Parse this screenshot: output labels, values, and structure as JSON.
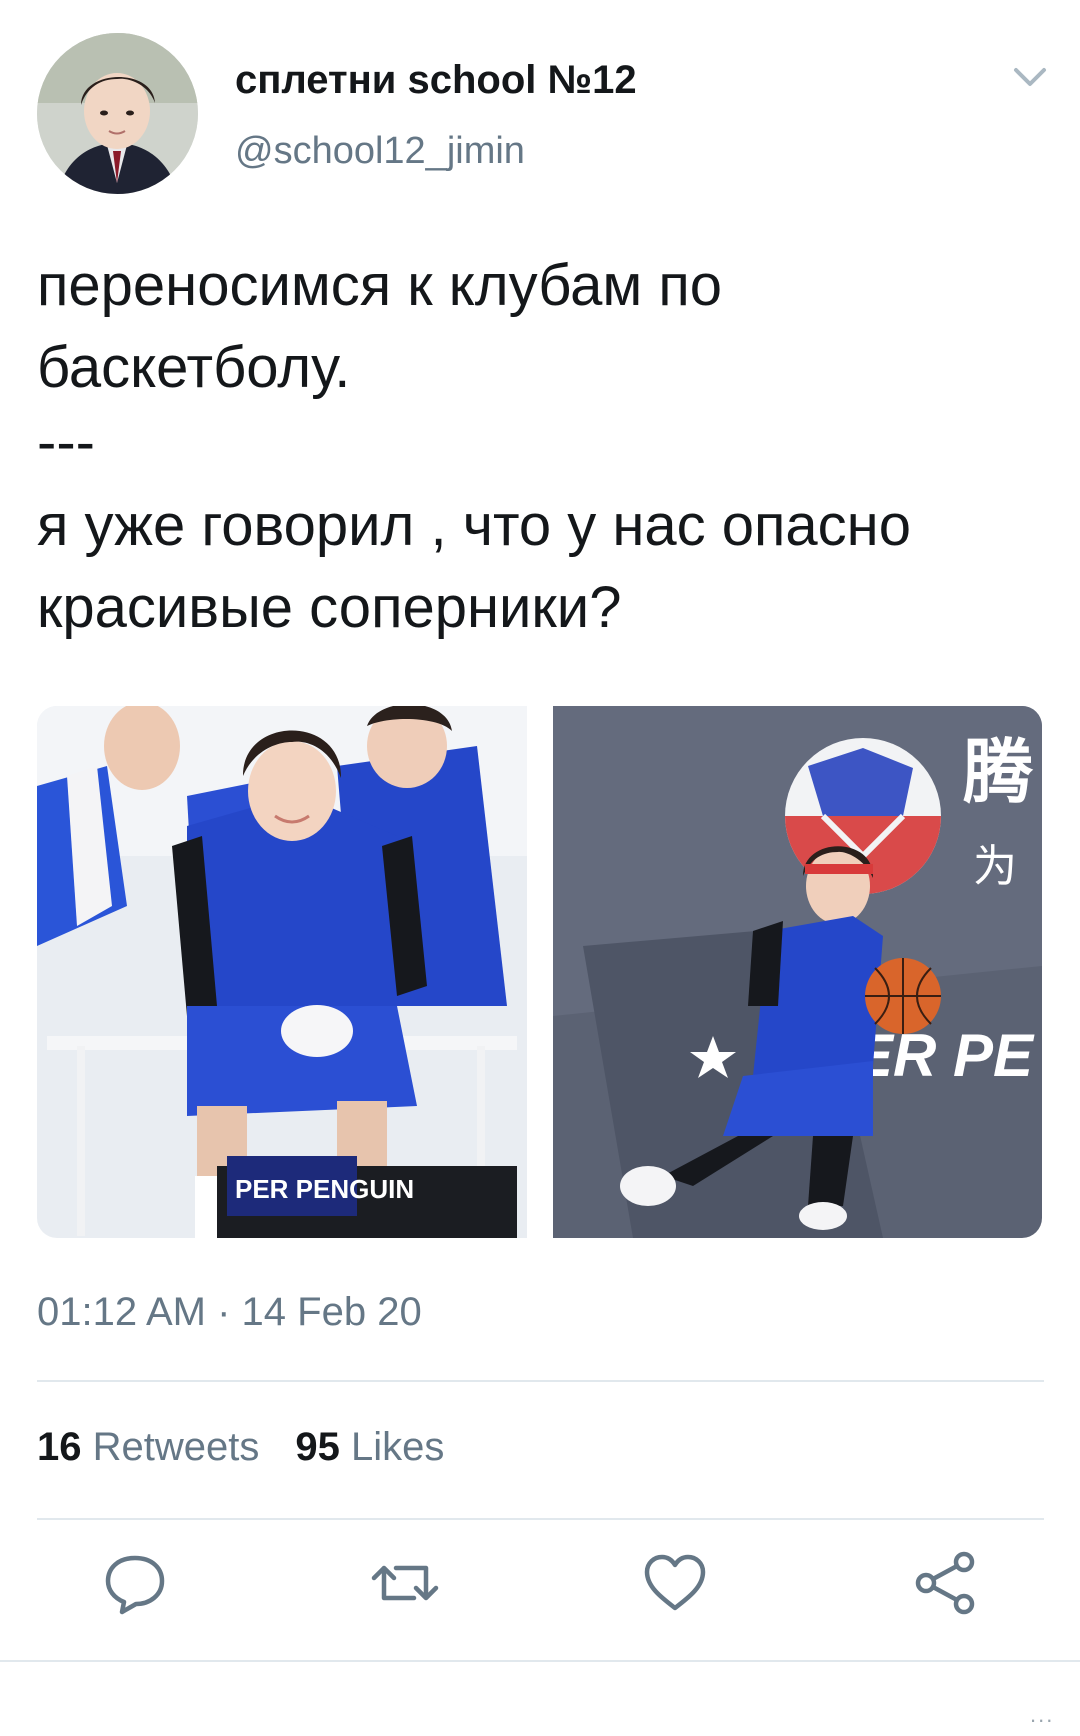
{
  "user": {
    "display_name": "сплетни school №12",
    "handle": "@school12_jimin"
  },
  "tweet": {
    "line1": "переносимся к клубам по баскетболу.",
    "separator": "---",
    "line2": "я уже говорил , что у нас опасно красивые соперники?"
  },
  "media": {
    "photo_left_text": "PER PENGUIN",
    "photo_right_text": "PER PE",
    "photo_right_cjk": [
      "腾",
      "为"
    ]
  },
  "timestamp": "01:12 AM · 14 Feb 20",
  "stats": {
    "retweets_count": "16",
    "retweets_label": "Retweets",
    "likes_count": "95",
    "likes_label": "Likes"
  },
  "actions": [
    "reply-icon",
    "retweet-icon",
    "like-icon",
    "share-icon"
  ],
  "footer": {
    "more": "..."
  },
  "colors": {
    "text": "#14171a",
    "secondary": "#657786",
    "divider": "#e1e8ed",
    "icon": "#657786",
    "jersey_blue": "#2547c9"
  }
}
